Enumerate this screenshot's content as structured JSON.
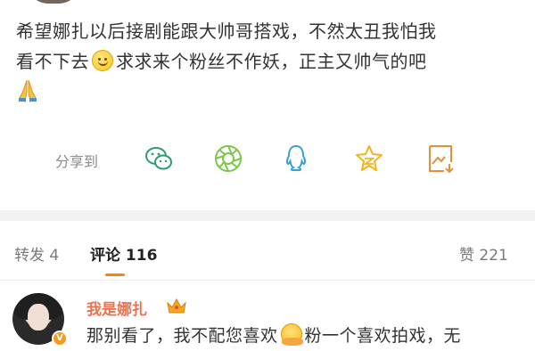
{
  "post": {
    "line1": "希望娜扎以后接剧能跟大帅哥搭戏，不然太丑我怕我",
    "line2a": "看不下去",
    "line2b": "求求来个粉丝不作妖，正主又帅气的吧",
    "emoji_smile": "smile-emoji-icon",
    "emoji_pray": "pray-emoji-icon"
  },
  "share": {
    "label": "分享到",
    "icons": [
      "wechat-icon",
      "moments-icon",
      "qq-icon",
      "qzone-star-icon",
      "save-image-icon"
    ],
    "color": "#2a9d6f"
  },
  "tabs": {
    "repost": "转发 4",
    "comments": "评论 116",
    "likes": "赞 221",
    "accent": "#ff8200"
  },
  "comment": {
    "name": "我是娜扎",
    "name_color": "#eb7350",
    "badge_icon": "crown-icon",
    "verified_icon": "verified-v-icon",
    "text_a": "那别看了，我不配您喜欢",
    "text_b": "粉一个喜欢拍戏，无"
  }
}
